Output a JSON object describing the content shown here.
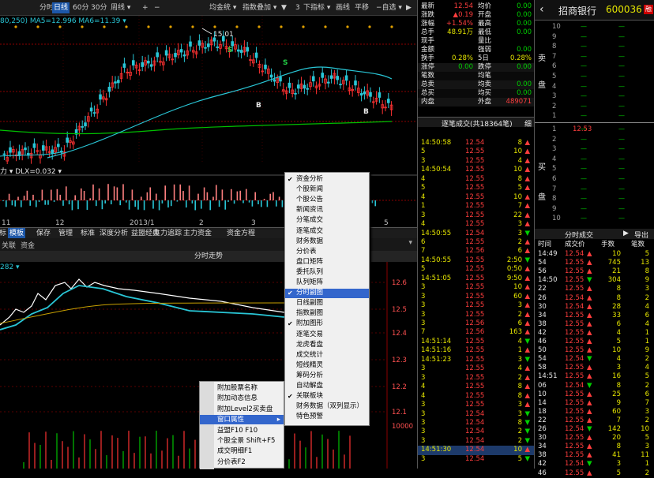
{
  "toolbar": {
    "items": [
      "分时",
      "日线",
      "60分",
      "30分",
      "周线 ▾",
      "+",
      "−",
      "均金统 ▾",
      "指数叠加 ▾",
      "▼",
      "3",
      "下指标 ▾",
      "画线",
      "平移",
      "−自选 ▾"
    ],
    "selected_index": 1
  },
  "main_chart": {
    "corner_text": "80,250) MA5=12.996 MA6=11.39 ▾",
    "high_label": "15.01",
    "markers": [
      "S",
      "S",
      "B",
      "B"
    ]
  },
  "volume": {
    "header": "力 ▾ DLX=0.032 ▾",
    "axis_labels": [
      "11",
      "12",
      "2013/1",
      "2",
      "3",
      "5"
    ]
  },
  "bottom_tabs": {
    "items": [
      "指标",
      "模板",
      "保存",
      "管理",
      "标准",
      "深度分析",
      "益盟经典",
      "主力追踪",
      "主力资金",
      "资金方程"
    ],
    "selected_index": 1
  },
  "sub_header": {
    "items": [
      "关联",
      "资金"
    ]
  },
  "timeline": {
    "title": "分时走势",
    "corner": "282 ▾",
    "price_labels": [
      "12.6",
      "12.5",
      "12.4",
      "12.3",
      "12.2",
      "12.1",
      "10000"
    ]
  },
  "quote": {
    "rows": [
      {
        "l1": "最新",
        "v1": "12.54",
        "l2": "均价",
        "v2": "0.00",
        "c1": "red",
        "c2": "grn"
      },
      {
        "l1": "涨跌",
        "v1": "▲0.19",
        "l2": "开盘",
        "v2": "0.00",
        "c1": "red",
        "c2": "grn"
      },
      {
        "l1": "涨幅",
        "v1": "+1.54%",
        "l2": "最高",
        "v2": "0.00",
        "c1": "red",
        "c2": "grn"
      },
      {
        "l1": "总手",
        "v1": "48.91万",
        "l2": "最低",
        "v2": "0.00",
        "c1": "yel",
        "c2": "grn"
      },
      {
        "l1": "现手",
        "v1": "",
        "l2": "量比",
        "v2": "",
        "c1": "wht",
        "c2": "wht"
      },
      {
        "l1": "金额",
        "v1": "",
        "l2": "强弱",
        "v2": "0.00",
        "c1": "wht",
        "c2": "grn"
      },
      {
        "l1": "换手",
        "v1": "0.28%",
        "l2": "5日",
        "v2": "0.28%",
        "c1": "yel",
        "c2": "yel"
      },
      {
        "l1": "涨停",
        "v1": "0.00",
        "l2": "跌停",
        "v2": "0.00",
        "c1": "grn",
        "c2": "grn"
      },
      {
        "l1": "笔数",
        "v1": "",
        "l2": "均笔",
        "v2": "",
        "c1": "wht",
        "c2": "wht"
      },
      {
        "l1": "总卖",
        "v1": "",
        "l2": "均卖",
        "v2": "0.00",
        "c1": "wht",
        "c2": "grn"
      },
      {
        "l1": "总买",
        "v1": "",
        "l2": "均买",
        "v2": "0.00",
        "c1": "wht",
        "c2": "grn"
      },
      {
        "l1": "内盘",
        "v1": "",
        "l2": "外盘",
        "v2": "489071",
        "c1": "grn",
        "c2": "red"
      }
    ],
    "tick_header": "逐笔成交(共18364笔)",
    "tick_header_right": "细"
  },
  "ticks": [
    {
      "t": "14:50:58",
      "p": "12.54",
      "v": "8",
      "a": "▲"
    },
    {
      "t": "5",
      "p": "12.55",
      "v": "10",
      "a": "▲"
    },
    {
      "t": "3",
      "p": "12.55",
      "v": "4",
      "a": "▲"
    },
    {
      "t": "14:50:54",
      "p": "12.55",
      "v": "10",
      "a": "▲"
    },
    {
      "t": "4",
      "p": "12.55",
      "v": "8",
      "a": "▲"
    },
    {
      "t": "5",
      "p": "12.55",
      "v": "5",
      "a": "▲"
    },
    {
      "t": "4",
      "p": "12.55",
      "v": "10",
      "a": "▲"
    },
    {
      "t": "1",
      "p": "12.55",
      "v": "7",
      "a": "▲"
    },
    {
      "t": "3",
      "p": "12.55",
      "v": "22",
      "a": "▲"
    },
    {
      "t": "4",
      "p": "12.55",
      "v": "3",
      "a": "▲"
    },
    {
      "t": "14:50:55",
      "p": "12.54",
      "v": "3",
      "a": "▼"
    },
    {
      "t": "6",
      "p": "12.55",
      "v": "2",
      "a": "▲"
    },
    {
      "t": "7",
      "p": "12.56",
      "v": "6",
      "a": "▲"
    },
    {
      "t": "14:50:55",
      "p": "12.55",
      "v": "2:50",
      "a": "▼"
    },
    {
      "t": "5",
      "p": "12.55",
      "v": "0:50",
      "a": "▲"
    },
    {
      "t": "14:51:05",
      "p": "12.55",
      "v": "9:50",
      "a": "▲"
    },
    {
      "t": "3",
      "p": "12.55",
      "v": "10",
      "a": "▲"
    },
    {
      "t": "3",
      "p": "12.55",
      "v": "60",
      "a": "▲"
    },
    {
      "t": "3",
      "p": "12.55",
      "v": "3",
      "a": "▲"
    },
    {
      "t": "3",
      "p": "12.55",
      "v": "2",
      "a": "▲"
    },
    {
      "t": "3",
      "p": "12.56",
      "v": "6",
      "a": "▲"
    },
    {
      "t": "7",
      "p": "12.56",
      "v": "163",
      "a": "▲"
    },
    {
      "t": "14:51:14",
      "p": "12.55",
      "v": "4",
      "a": "▼"
    },
    {
      "t": "14:51:16",
      "p": "12.55",
      "v": "1",
      "a": "▲"
    },
    {
      "t": "14:51:23",
      "p": "12.55",
      "v": "3",
      "a": "▼"
    },
    {
      "t": "3",
      "p": "12.55",
      "v": "4",
      "a": "▲"
    },
    {
      "t": "3",
      "p": "12.55",
      "v": "2",
      "a": "▲"
    },
    {
      "t": "4",
      "p": "12.55",
      "v": "8",
      "a": "▲"
    },
    {
      "t": "4",
      "p": "12.55",
      "v": "8",
      "a": "▲"
    },
    {
      "t": "3",
      "p": "12.55",
      "v": "3",
      "a": "▲"
    },
    {
      "t": "3",
      "p": "12.54",
      "v": "3",
      "a": "▼"
    },
    {
      "t": "3",
      "p": "12.54",
      "v": "8",
      "a": "▼"
    },
    {
      "t": "3",
      "p": "12.54",
      "v": "2",
      "a": "▼"
    },
    {
      "t": "3",
      "p": "12.54",
      "v": "2",
      "a": "▼"
    },
    {
      "t": "14:51:30",
      "p": "12.54",
      "v": "10",
      "a": "▲"
    },
    {
      "t": "3",
      "p": "12.54",
      "v": "5",
      "a": "▼"
    }
  ],
  "right": {
    "name": "招商银行",
    "code": "600036",
    "sell_label": "卖",
    "sell_label2": "盘",
    "buy_label": "买",
    "buy_label2": "盘",
    "levels": [
      "10",
      "9",
      "8",
      "7",
      "6",
      "5",
      "4",
      "3",
      "2",
      "1",
      "1",
      "2",
      "3",
      "4",
      "5",
      "6",
      "7",
      "8",
      "9",
      "10"
    ],
    "buy1_price": "12.53",
    "fs_title": "分时成交",
    "fs_btn": "导出",
    "fs_cols": [
      "时间",
      "成交价",
      "手数",
      "笔数"
    ],
    "fs_rows": [
      {
        "t": "14:49",
        "p": "12.54",
        "v": "10",
        "n": "5",
        "a": "▲"
      },
      {
        "t": "54",
        "p": "12.55",
        "v": "745",
        "n": "13",
        "a": "▲"
      },
      {
        "t": "56",
        "p": "12.55",
        "v": "21",
        "n": "8",
        "a": "▲"
      },
      {
        "t": "14:50",
        "p": "12.55",
        "v": "304",
        "n": "9",
        "a": "▼"
      },
      {
        "t": "22",
        "p": "12.55",
        "v": "8",
        "n": "3",
        "a": "▲"
      },
      {
        "t": "26",
        "p": "12.54",
        "v": "8",
        "n": "2",
        "a": "▲"
      },
      {
        "t": "30",
        "p": "12.54",
        "v": "28",
        "n": "4",
        "a": "▲"
      },
      {
        "t": "34",
        "p": "12.55",
        "v": "33",
        "n": "6",
        "a": "▲"
      },
      {
        "t": "38",
        "p": "12.55",
        "v": "6",
        "n": "4",
        "a": "▲"
      },
      {
        "t": "42",
        "p": "12.55",
        "v": "4",
        "n": "1",
        "a": "▲"
      },
      {
        "t": "46",
        "p": "12.55",
        "v": "5",
        "n": "1",
        "a": "▲"
      },
      {
        "t": "50",
        "p": "12.55",
        "v": "10",
        "n": "9",
        "a": "▲"
      },
      {
        "t": "54",
        "p": "12.54",
        "v": "4",
        "n": "2",
        "a": "▼"
      },
      {
        "t": "58",
        "p": "12.55",
        "v": "3",
        "n": "4",
        "a": "▲"
      },
      {
        "t": "14:51",
        "p": "12.55",
        "v": "16",
        "n": "5",
        "a": "▲"
      },
      {
        "t": "06",
        "p": "12.54",
        "v": "8",
        "n": "2",
        "a": "▼"
      },
      {
        "t": "10",
        "p": "12.55",
        "v": "25",
        "n": "6",
        "a": "▲"
      },
      {
        "t": "14",
        "p": "12.55",
        "v": "9",
        "n": "7",
        "a": "▲"
      },
      {
        "t": "18",
        "p": "12.55",
        "v": "60",
        "n": "3",
        "a": "▲"
      },
      {
        "t": "22",
        "p": "12.55",
        "v": "7",
        "n": "2",
        "a": "▲"
      },
      {
        "t": "26",
        "p": "12.54",
        "v": "142",
        "n": "10",
        "a": "▼"
      },
      {
        "t": "30",
        "p": "12.55",
        "v": "20",
        "n": "5",
        "a": "▲"
      },
      {
        "t": "34",
        "p": "12.55",
        "v": "8",
        "n": "3",
        "a": "▲"
      },
      {
        "t": "38",
        "p": "12.55",
        "v": "41",
        "n": "11",
        "a": "▲"
      },
      {
        "t": "42",
        "p": "12.54",
        "v": "3",
        "n": "1",
        "a": "▼"
      },
      {
        "t": "46",
        "p": "12.55",
        "v": "5",
        "n": "2",
        "a": "▲"
      }
    ]
  },
  "context_menu": {
    "items": [
      {
        "label": "资金分析",
        "checked": true
      },
      {
        "label": "个股新闻",
        "checked": false
      },
      {
        "label": "个股公告",
        "checked": false
      },
      {
        "label": "新闻资讯",
        "checked": false
      },
      {
        "label": "分笔成交",
        "checked": false
      },
      {
        "label": "逐笔成交",
        "checked": false
      },
      {
        "label": "财务数据",
        "checked": false
      },
      {
        "label": "分价表",
        "checked": false
      },
      {
        "label": "盘口矩阵",
        "checked": false
      },
      {
        "label": "委托队列",
        "checked": false
      },
      {
        "label": "队列矩阵",
        "checked": false
      },
      {
        "label": "分时副图",
        "checked": true
      },
      {
        "label": "日线副图",
        "checked": false
      },
      {
        "label": "指数副图",
        "checked": false
      },
      {
        "label": "附加图形",
        "checked": true
      },
      {
        "label": "逐笔交易",
        "checked": false
      },
      {
        "label": "龙虎看盘",
        "checked": false
      },
      {
        "label": "成交统计",
        "checked": false
      },
      {
        "label": "短线精灵",
        "checked": false
      },
      {
        "label": "筹码分析",
        "checked": false
      },
      {
        "label": "自动解盘",
        "checked": false
      },
      {
        "label": "关联板块",
        "checked": true
      },
      {
        "label": "财务数据（双列显示）",
        "checked": false
      },
      {
        "label": "特色预警",
        "checked": false
      }
    ],
    "highlight_index": 11
  },
  "context_menu2": {
    "items": [
      "附加股票名称",
      "附加动态信息",
      "附加Level2买卖盘",
      "窗口属性",
      "益盟F10   F10",
      "个股全景 Shift+F5",
      "成交明细F1",
      "分价表F2"
    ],
    "highlight_index": 3
  }
}
